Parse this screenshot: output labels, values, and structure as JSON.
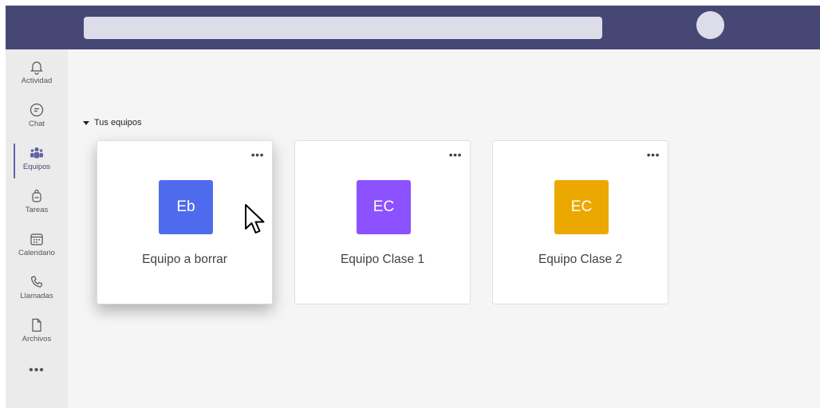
{
  "rail": {
    "items": [
      {
        "label": "Actividad",
        "icon": "bell-icon"
      },
      {
        "label": "Chat",
        "icon": "chat-icon"
      },
      {
        "label": "Equipos",
        "icon": "teams-icon",
        "active": true
      },
      {
        "label": "Tareas",
        "icon": "backpack-icon"
      },
      {
        "label": "Calendario",
        "icon": "calendar-icon"
      },
      {
        "label": "Llamadas",
        "icon": "phone-icon"
      },
      {
        "label": "Archivos",
        "icon": "file-icon"
      }
    ],
    "more": "•••"
  },
  "section": {
    "title": "Tus equipos"
  },
  "teams": [
    {
      "initials": "Eb",
      "name": "Equipo a borrar",
      "color": "#4f6bed",
      "more": "•••"
    },
    {
      "initials": "EC",
      "name": "Equipo Clase 1",
      "color": "#8c52ff",
      "more": "•••"
    },
    {
      "initials": "EC",
      "name": "Equipo Clase 2",
      "color": "#eba800",
      "more": "•••"
    }
  ],
  "colors": {
    "topbar": "#464775",
    "accent": "#6264a7",
    "background": "#f5f5f5"
  }
}
